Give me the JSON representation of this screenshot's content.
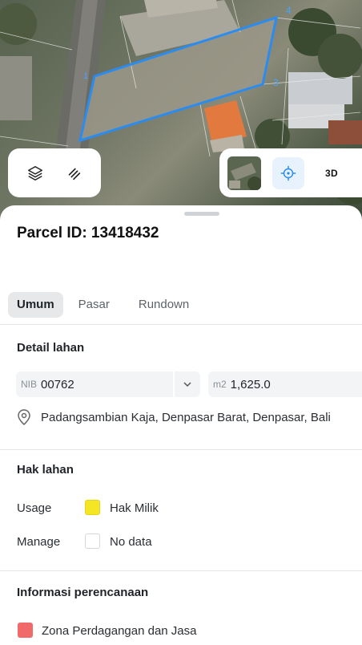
{
  "map": {
    "vertex_labels": [
      "1",
      "3",
      "4"
    ],
    "parcel_outline_color": "#2b8cf0"
  },
  "map_controls": {
    "left": [
      {
        "name": "layers-icon"
      },
      {
        "name": "draw-tool-icon"
      }
    ],
    "right": {
      "basemap_thumbnail": "satellite-thumbnail",
      "locate_icon": "crosshair-icon",
      "three_d_label": "3D"
    }
  },
  "parcel": {
    "title": "Parcel ID: 13418432"
  },
  "tabs": [
    {
      "label": "Umum",
      "active": true
    },
    {
      "label": "Pasar",
      "active": false
    },
    {
      "label": "Rundown",
      "active": false
    }
  ],
  "detail_lahan": {
    "heading": "Detail lahan",
    "nib_prefix": "NIB",
    "nib_value": "00762",
    "area_prefix": "m2",
    "area_value": "1,625.0",
    "address": "Padangsambian Kaja, Denpasar Barat, Denpasar, Bali"
  },
  "hak_lahan": {
    "heading": "Hak lahan",
    "rows": [
      {
        "label": "Usage",
        "value": "Hak Milik",
        "swatch_color": "#f5e524"
      },
      {
        "label": "Manage",
        "value": "No data",
        "swatch_color": "#ffffff"
      }
    ]
  },
  "perencanaan": {
    "heading": "Informasi perencanaan",
    "zone": "Zona Perdagangan dan Jasa",
    "zone_color": "#f06a6a"
  }
}
